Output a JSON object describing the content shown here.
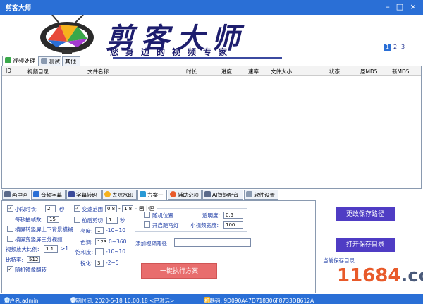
{
  "window": {
    "title": "剪客大师",
    "minimize_icon": "minimize-icon",
    "maximize_icon": "maximize-icon",
    "close_icon": "close-icon"
  },
  "banner": {
    "brand_title": "剪客大师",
    "slogan": "您身边的视频专家",
    "pages": [
      "1",
      "2",
      "3"
    ],
    "selected_page": "1",
    "logo": "tv-logo"
  },
  "top_tabs": [
    {
      "label": "视频处理",
      "icon": "video-icon",
      "active": true
    },
    {
      "label": "测试",
      "icon": "table-icon",
      "active": false
    },
    {
      "label": "其他",
      "icon": "",
      "active": false
    }
  ],
  "grid": {
    "columns": [
      "ID",
      "视频目录",
      "文件名称",
      "时长",
      "进度",
      "速率",
      "文件大小",
      "状态",
      "原MD5",
      "新MD5"
    ],
    "rows": []
  },
  "bottom_tabs": [
    {
      "label": "画中画",
      "icon": "picture-icon"
    },
    {
      "label": "音频字幕",
      "icon": "audio-icon"
    },
    {
      "label": "字幕转码",
      "icon": "subtitle-icon"
    },
    {
      "label": "去除水印",
      "icon": "watermark-icon"
    },
    {
      "label": "方案一",
      "icon": "scheme-icon",
      "active": true
    },
    {
      "label": "辅助杂项",
      "icon": "misc-icon"
    },
    {
      "label": "AI智能配音",
      "icon": "ai-icon"
    },
    {
      "label": "软件设置",
      "icon": "settings-icon"
    }
  ],
  "scheme": {
    "segment_duration_label": "小段时长:",
    "segment_duration_value": "2",
    "segment_duration_unit": "秒",
    "frames_per_sec_label": "每秒抽帧数:",
    "frames_per_sec_value": "15",
    "flip_blur_label": "横屏转竖屏上下背景模糊",
    "flip_three_label": "横屏变竖屏三分视频",
    "zoom_ratio_label": "视频放大比例:",
    "zoom_ratio_value": "1.1",
    "zoom_ratio_unit": ">1",
    "bitrate_label": "比特率:",
    "bitrate_value": "512",
    "random_mirror_label": "随机镜像翻转",
    "speed_range_label": "变速范围",
    "speed_min": "0.8",
    "speed_sep": "-",
    "speed_max": "1.8",
    "trim_label": "前后剪切",
    "trim_value": "1",
    "trim_unit": "秒",
    "brightness_label": "亮度:",
    "brightness_value": "1",
    "brightness_range": "-10~10",
    "hue_label": "色调:",
    "hue_value": "123",
    "hue_range": "0~360",
    "saturation_label": "饱和度:",
    "saturation_value": "1",
    "saturation_range": "-10~10",
    "sharpen_label": "锐化:",
    "sharpen_value": "3",
    "sharpen_range": "-2~5",
    "pip_group_label": "画中画",
    "random_position_label": "随机位置",
    "marquee_label": "开启跑马灯",
    "opacity_label": "透明度:",
    "opacity_value": "0.5",
    "small_width_label": "小视频宽度:",
    "small_width_value": "100",
    "add_video_path_label": "添加视频路径:",
    "add_video_path_value": "",
    "run_button": "一键执行方案"
  },
  "side_buttons": {
    "change_path": "更改保存路径",
    "open_path": "打开保存目录",
    "current_dir_label": "当前保存目录:"
  },
  "statusbar": {
    "user": "用户名:admin",
    "expiry": "到期时间: 2020-5-18 10:00:18 <已激活>",
    "machine": "机器码: 9D090A47D718306F8733DB612A"
  },
  "watermark": {
    "text_a": "11684",
    "text_b": ".com"
  },
  "colors": {
    "titlebar": "#2a6fd6",
    "purple_button": "#4f3cc4",
    "run_button": "#e86d6d",
    "brand": "#1e1e6e"
  }
}
